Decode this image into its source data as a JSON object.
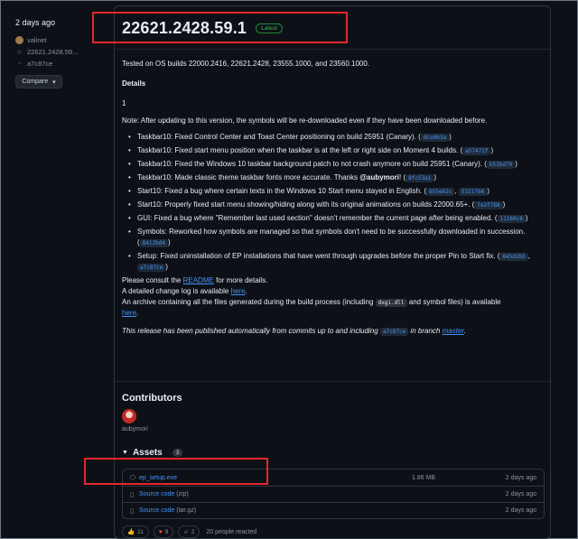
{
  "meta": {
    "date": "2 days ago",
    "author": "valinet",
    "tag": "22621.2428.59...",
    "commit": "a7c87ce",
    "compare_label": "Compare"
  },
  "release": {
    "title": "22621.2428.59.1",
    "badge": "Latest",
    "tested": "Tested on OS builds 22000.2416, 22621.2428, 23555.1000, and 23560.1000.",
    "details_heading": "Details",
    "number": "1",
    "note": "Note: After updating to this version, the symbols will be re-downloaded even if they have been downloaded before.",
    "changes": [
      {
        "text": "Taskbar10: Fixed Control Center and Toast Center positioning on build 25951 (Canary).",
        "commits": [
          "dca0b3a"
        ]
      },
      {
        "text": "Taskbar10: Fixed start menu position when the taskbar is at the left or right side on Moment 4 builds.",
        "commits": [
          "a57471f"
        ]
      },
      {
        "text": "Taskbar10: Fixed the Windows 10 taskbar background patch to not crash anymore on build 25951 (Canary).",
        "commits": [
          "b52bd79"
        ]
      },
      {
        "text": "Taskbar10: Made classic theme taskbar fonts more accurate. Thanks ",
        "mention": "@aubymori",
        "suffix": "!",
        "commits": [
          "8fc53a1"
        ]
      },
      {
        "text": "Start10: Fixed a bug where certain texts in the Windows 10 Start menu stayed in English.",
        "commits": [
          "655e62c",
          "5321766"
        ]
      },
      {
        "text": "Start10: Properly fixed start menu showing/hiding along with its original animations on builds 22000.65+.",
        "commits": [
          "7e2f768"
        ]
      },
      {
        "text": "GUI: Fixed a bug where \"Remember last used section\" doesn't remember the current page after being enabled.",
        "commits": [
          "11160c8"
        ]
      },
      {
        "text": "Symbols: Reworked how symbols are managed so that symbols don't need to be successfully downloaded in succession.",
        "commits": [
          "8412bd4"
        ]
      },
      {
        "text": "Setup: Fixed uninstallation of EP installations that have went through upgrades before the proper Pin to Start fix.",
        "commits": [
          "845d2b5",
          "a7c87ce"
        ]
      }
    ],
    "consult_pre": "Please consult the ",
    "readme_link": "README",
    "consult_post": " for more details.",
    "changelog_pre": "A detailed change log is available ",
    "changelog_link": "here",
    "changelog_post": ".",
    "archive_pre": "An archive containing all the files generated during the build process (including ",
    "archive_code": "dxgi.dll",
    "archive_mid": " and symbol files) is available",
    "archive_link": "here",
    "archive_post": ".",
    "auto_pre": "This release has been published automatically from commits up to and including ",
    "auto_commit": "a7c87ce",
    "auto_mid": " in branch ",
    "auto_branch": "master",
    "auto_post": "."
  },
  "contributors": {
    "heading": "Contributors",
    "names": [
      "aubymori"
    ]
  },
  "assets": {
    "heading": "Assets",
    "count": "3",
    "items": [
      {
        "name": "ep_setup.exe",
        "size": "1.86 MB",
        "date": "2 days ago"
      },
      {
        "name": "Source code",
        "suffix": "(zip)",
        "size": "",
        "date": "2 days ago"
      },
      {
        "name": "Source code",
        "suffix": "(tar.gz)",
        "size": "",
        "date": "2 days ago"
      }
    ]
  },
  "reactions": {
    "thumbs_up": "11",
    "heart": "9",
    "rocket": "2",
    "summary": "20 people reacted"
  },
  "colors": {
    "background": "#0d1117",
    "link": "#4493f8",
    "latest_badge": "#3fb950",
    "annotation": "#e5262b"
  }
}
